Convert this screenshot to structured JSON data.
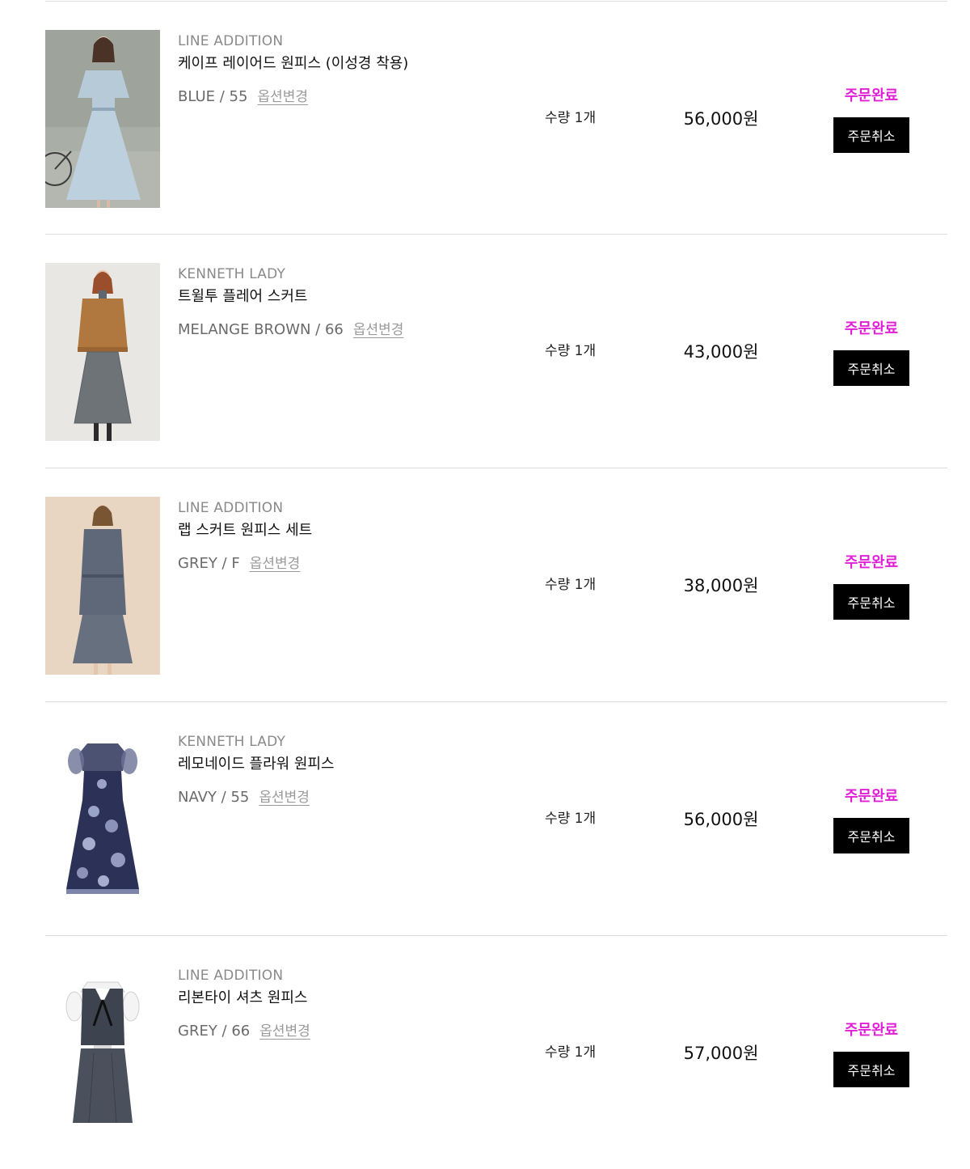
{
  "orders": [
    {
      "brand": "LINE ADDITION",
      "name": "케이프 레이어드 원피스 (이성경 착용)",
      "option": "BLUE / 55",
      "option_change": "옵션변경",
      "quantity": "수량 1개",
      "price": "56,000원",
      "status": "주문완료",
      "cancel_label": "주문취소"
    },
    {
      "brand": "KENNETH LADY",
      "name": "트윌투 플레어 스커트",
      "option": "MELANGE BROWN / 66",
      "option_change": "옵션변경",
      "quantity": "수량 1개",
      "price": "43,000원",
      "status": "주문완료",
      "cancel_label": "주문취소"
    },
    {
      "brand": "LINE ADDITION",
      "name": "랩 스커트 원피스 세트",
      "option": "GREY / F",
      "option_change": "옵션변경",
      "quantity": "수량 1개",
      "price": "38,000원",
      "status": "주문완료",
      "cancel_label": "주문취소"
    },
    {
      "brand": "KENNETH LADY",
      "name": "레모네이드 플라워 원피스",
      "option": "NAVY / 55",
      "option_change": "옵션변경",
      "quantity": "수량 1개",
      "price": "56,000원",
      "status": "주문완료",
      "cancel_label": "주문취소"
    },
    {
      "brand": "LINE ADDITION",
      "name": "리본타이 셔츠 원피스",
      "option": "GREY / 66",
      "option_change": "옵션변경",
      "quantity": "수량 1개",
      "price": "57,000원",
      "status": "주문완료",
      "cancel_label": "주문취소"
    }
  ],
  "colors": {
    "status": "#e01fd6",
    "cancel_bg": "#000000",
    "divider": "#dcdcdc"
  }
}
